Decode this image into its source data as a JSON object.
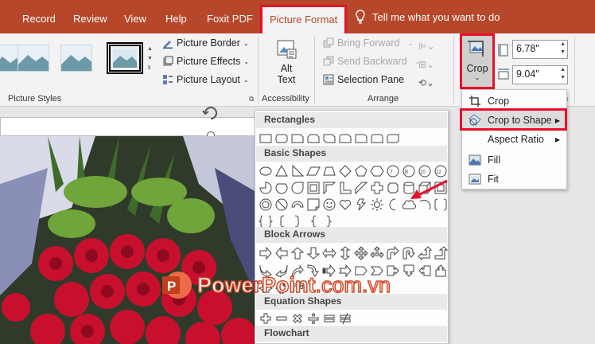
{
  "tabs": [
    "Record",
    "Review",
    "View",
    "Help",
    "Foxit PDF",
    "Picture Format"
  ],
  "tell_me": "Tell me what you want to do",
  "ribbon": {
    "picture_border": "Picture Border",
    "picture_effects": "Picture Effects",
    "picture_layout": "Picture Layout",
    "picture_styles_label": "Picture Styles",
    "alt_text_line1": "Alt",
    "alt_text_line2": "Text",
    "accessibility_label": "Accessibility",
    "bring_forward": "Bring Forward",
    "send_backward": "Send Backward",
    "selection_pane": "Selection Pane",
    "arrange_label": "Arrange",
    "crop": "Crop",
    "height_value": "6.78\"",
    "width_value": "9.04\""
  },
  "crop_menu": {
    "items": [
      "Crop",
      "Crop to Shape",
      "Aspect Ratio",
      "Fill",
      "Fit"
    ]
  },
  "shapes_menu": {
    "categories": [
      "Rectangles",
      "Basic Shapes",
      "Block Arrows",
      "Equation Shapes",
      "Flowchart"
    ]
  },
  "brand": {
    "name": "PowerPoint",
    "suffix": ".com.vn",
    "colors": {
      "ribbon": "#b7472a",
      "highlight": "#e8102a",
      "brand": "#d24726"
    }
  }
}
